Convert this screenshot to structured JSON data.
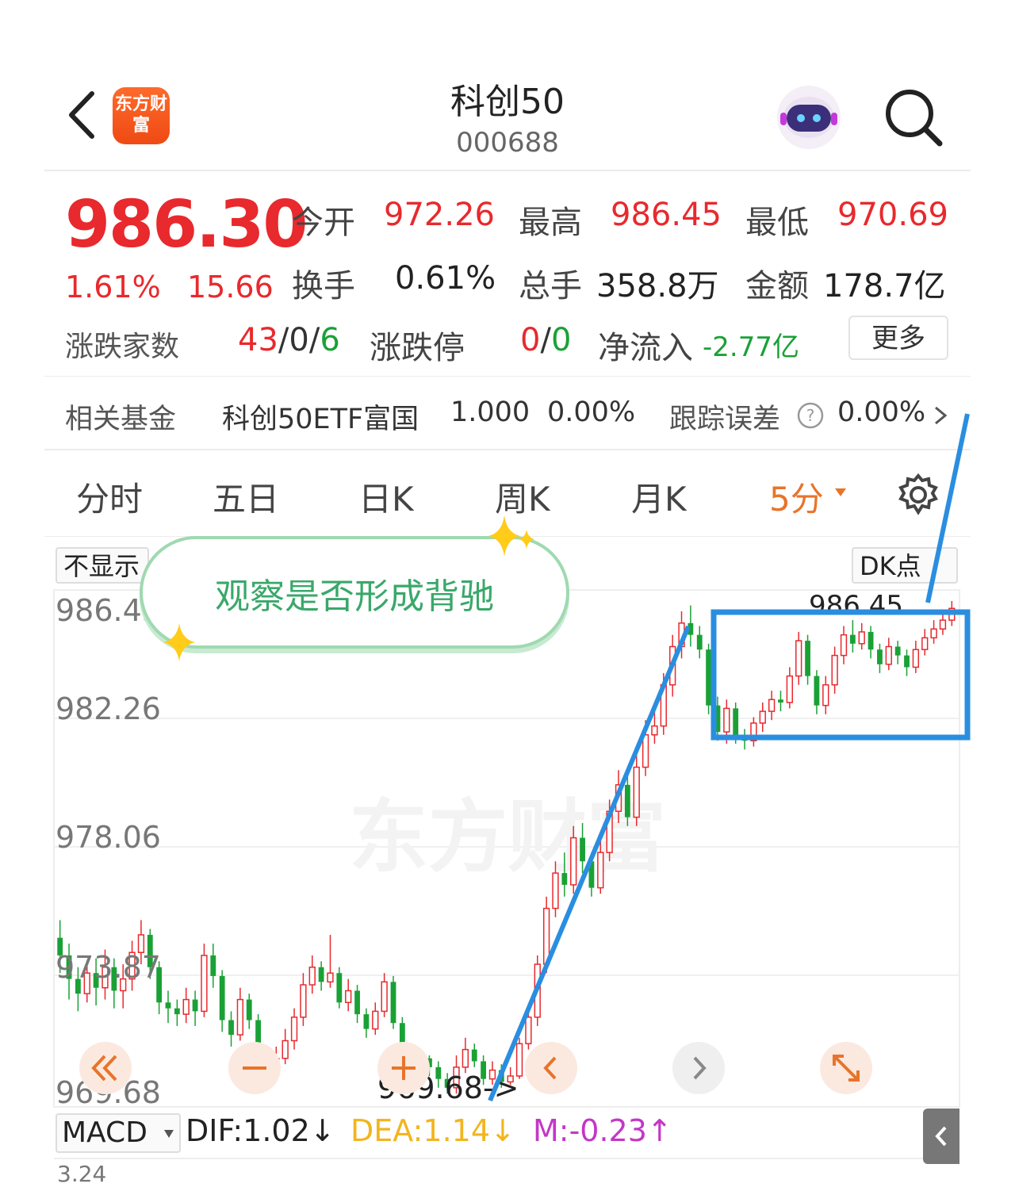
{
  "header": {
    "back_icon": "chevron-left-icon",
    "logo_text": "东方财富",
    "title": "科创50",
    "code": "000688",
    "robot_icon": "robot-assistant-icon",
    "search_icon": "search-icon"
  },
  "quote": {
    "price": "986.30",
    "change_pct": "1.61%",
    "change": "15.66",
    "open_label": "今开",
    "open": "972.26",
    "high_label": "最高",
    "high": "986.45",
    "low_label": "最低",
    "low": "970.69",
    "turnover_label": "换手",
    "turnover": "0.61%",
    "volume_label": "总手",
    "volume": "358.8万",
    "amount_label": "金额",
    "amount": "178.7亿",
    "breadth_label": "涨跌家数",
    "breadth_up": "43",
    "breadth_flat": "0",
    "breadth_down": "6",
    "limit_label": "涨跌停",
    "limit_up": "0",
    "limit_down": "0",
    "netflow_label": "净流入",
    "netflow": "-2.77亿",
    "more_label": "更多"
  },
  "fund": {
    "label": "相关基金",
    "name": "科创50ETF富国",
    "nav": "1.000",
    "pct": "0.00%",
    "track_label": "跟踪误差",
    "track_value": "0.00%"
  },
  "tabs": [
    {
      "label": "分时"
    },
    {
      "label": "五日"
    },
    {
      "label": "日K"
    },
    {
      "label": "周K"
    },
    {
      "label": "月K"
    },
    {
      "label": "5分"
    }
  ],
  "chart_controls": {
    "hide_label": "不显示",
    "dk_label": "DK点",
    "annotation": "观察是否形成背驰",
    "high_marker": "986.45",
    "low_marker": "969.68->"
  },
  "macd": {
    "name": "MACD",
    "dif": "DIF:1.02↓",
    "dea": "DEA:1.14↓",
    "m": "M:-0.23↑",
    "axis_top": "3.24"
  },
  "colors": {
    "up": "#e8292d",
    "down": "#1aa136",
    "accent": "#e8742a",
    "annotation_line": "#2a8ee0",
    "pill_border": "#9fd9b0"
  },
  "chart_data": {
    "type": "candlestick",
    "y_ticks": [
      "986.45",
      "982.26",
      "978.06",
      "973.87",
      "969.68"
    ],
    "ylim": [
      969.68,
      986.45
    ],
    "candles": [
      [
        975.0,
        974.4,
        975.6,
        973.8
      ],
      [
        974.4,
        973.6,
        974.8,
        972.9
      ],
      [
        973.6,
        973.1,
        974.0,
        972.5
      ],
      [
        973.1,
        973.8,
        974.2,
        972.8
      ],
      [
        973.8,
        973.3,
        974.3,
        972.7
      ],
      [
        973.3,
        974.0,
        974.6,
        972.9
      ],
      [
        974.0,
        973.2,
        974.3,
        972.6
      ],
      [
        973.2,
        973.6,
        974.1,
        972.6
      ],
      [
        973.6,
        974.5,
        974.9,
        973.2
      ],
      [
        974.5,
        975.1,
        975.6,
        974.1
      ],
      [
        975.1,
        974.0,
        975.3,
        973.6
      ],
      [
        974.0,
        972.8,
        974.2,
        972.4
      ],
      [
        972.8,
        972.6,
        973.2,
        972.1
      ],
      [
        972.6,
        972.4,
        972.9,
        972.0
      ],
      [
        972.4,
        972.9,
        973.3,
        972.1
      ],
      [
        972.9,
        972.5,
        973.2,
        972.0
      ],
      [
        972.5,
        974.4,
        974.8,
        972.3
      ],
      [
        974.4,
        973.7,
        974.8,
        973.3
      ],
      [
        973.7,
        972.2,
        973.9,
        971.8
      ],
      [
        972.2,
        971.7,
        972.5,
        971.3
      ],
      [
        971.7,
        972.9,
        973.3,
        971.5
      ],
      [
        972.9,
        972.2,
        973.1,
        971.9
      ],
      [
        972.2,
        971.0,
        972.4,
        970.6
      ],
      [
        971.0,
        970.7,
        971.2,
        970.3
      ],
      [
        970.7,
        970.9,
        971.3,
        970.4
      ],
      [
        970.9,
        971.5,
        971.9,
        970.7
      ],
      [
        971.5,
        972.3,
        972.6,
        971.2
      ],
      [
        972.3,
        973.4,
        973.8,
        972.0
      ],
      [
        973.4,
        974.0,
        974.4,
        973.1
      ],
      [
        974.0,
        973.5,
        974.2,
        973.2
      ],
      [
        973.5,
        973.8,
        975.1,
        973.3
      ],
      [
        973.8,
        972.8,
        974.0,
        972.6
      ],
      [
        972.8,
        973.2,
        973.6,
        972.5
      ],
      [
        973.2,
        972.4,
        973.4,
        972.1
      ],
      [
        972.4,
        971.9,
        972.6,
        971.6
      ],
      [
        971.9,
        972.5,
        972.8,
        971.7
      ],
      [
        972.5,
        973.5,
        973.8,
        972.3
      ],
      [
        973.5,
        972.1,
        973.7,
        971.9
      ],
      [
        972.1,
        971.2,
        972.3,
        970.9
      ],
      [
        971.2,
        970.5,
        971.4,
        970.2
      ],
      [
        970.5,
        970.9,
        971.2,
        970.3
      ],
      [
        970.9,
        970.6,
        971.0,
        970.3
      ],
      [
        970.6,
        970.2,
        970.8,
        969.9
      ],
      [
        970.2,
        969.9,
        970.4,
        969.7
      ],
      [
        969.9,
        970.6,
        971.0,
        969.7
      ],
      [
        970.6,
        971.2,
        971.6,
        970.4
      ],
      [
        971.2,
        970.8,
        971.4,
        970.6
      ],
      [
        970.8,
        970.2,
        971.0,
        970.0
      ],
      [
        970.2,
        970.5,
        970.8,
        970.0
      ],
      [
        970.5,
        970.1,
        970.7,
        969.9
      ],
      [
        970.1,
        970.3,
        970.6,
        970.0
      ],
      [
        970.3,
        971.4,
        971.6,
        970.2
      ],
      [
        971.4,
        972.3,
        972.7,
        971.2
      ],
      [
        972.3,
        974.1,
        974.4,
        972.0
      ],
      [
        974.1,
        976.0,
        976.4,
        973.8
      ],
      [
        976.0,
        977.2,
        977.6,
        975.7
      ],
      [
        977.2,
        976.8,
        977.9,
        976.4
      ],
      [
        976.8,
        978.4,
        978.8,
        976.5
      ],
      [
        978.4,
        977.6,
        978.9,
        977.2
      ],
      [
        977.6,
        976.7,
        977.9,
        976.4
      ],
      [
        976.7,
        977.9,
        978.3,
        976.5
      ],
      [
        977.9,
        979.3,
        979.7,
        977.6
      ],
      [
        979.3,
        980.2,
        980.7,
        978.9
      ],
      [
        980.2,
        979.1,
        980.5,
        978.8
      ],
      [
        979.1,
        980.8,
        981.3,
        978.8
      ],
      [
        980.8,
        981.9,
        982.4,
        980.5
      ],
      [
        981.9,
        982.2,
        982.7,
        981.6
      ],
      [
        982.2,
        983.6,
        984.0,
        981.9
      ],
      [
        983.6,
        984.9,
        985.3,
        983.2
      ],
      [
        984.9,
        985.7,
        986.1,
        984.5
      ],
      [
        985.7,
        985.3,
        986.3,
        984.9
      ],
      [
        985.3,
        984.8,
        985.6,
        984.5
      ],
      [
        984.8,
        982.9,
        985.0,
        982.6
      ],
      [
        982.9,
        982.0,
        983.2,
        981.7
      ],
      [
        982.0,
        982.8,
        983.1,
        981.6
      ],
      [
        982.8,
        981.9,
        983.0,
        981.6
      ],
      [
        981.9,
        981.7,
        982.1,
        981.4
      ],
      [
        981.7,
        982.3,
        982.5,
        981.5
      ],
      [
        982.3,
        982.7,
        983.0,
        982.0
      ],
      [
        982.7,
        983.1,
        983.4,
        982.4
      ],
      [
        983.1,
        983.0,
        983.4,
        982.7
      ],
      [
        983.0,
        983.9,
        984.2,
        982.8
      ],
      [
        983.9,
        985.1,
        985.4,
        983.6
      ],
      [
        985.1,
        983.9,
        985.3,
        983.6
      ],
      [
        983.9,
        982.9,
        984.1,
        982.6
      ],
      [
        982.9,
        983.6,
        983.9,
        982.6
      ],
      [
        983.6,
        984.6,
        984.9,
        983.3
      ],
      [
        984.6,
        985.3,
        985.6,
        984.3
      ],
      [
        985.3,
        985.0,
        985.8,
        984.7
      ],
      [
        985.0,
        985.4,
        985.7,
        984.8
      ],
      [
        985.4,
        984.8,
        985.6,
        984.5
      ],
      [
        984.8,
        984.3,
        985.0,
        984.0
      ],
      [
        984.3,
        984.9,
        985.2,
        984.1
      ],
      [
        984.9,
        984.6,
        985.1,
        984.3
      ],
      [
        984.6,
        984.2,
        984.8,
        983.9
      ],
      [
        984.2,
        984.8,
        985.1,
        984.0
      ],
      [
        984.8,
        985.2,
        985.5,
        984.6
      ],
      [
        985.2,
        985.5,
        985.8,
        985.0
      ],
      [
        985.5,
        985.8,
        986.1,
        985.3
      ],
      [
        985.8,
        986.2,
        986.45,
        985.6
      ]
    ],
    "candle_fields": [
      "open",
      "close",
      "high",
      "low"
    ]
  }
}
